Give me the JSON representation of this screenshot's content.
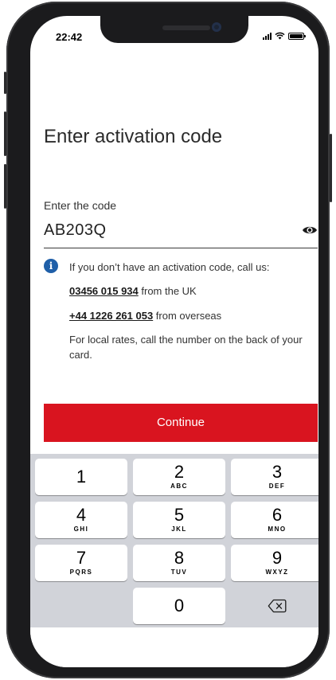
{
  "status_bar": {
    "time": "22:42"
  },
  "page": {
    "title": "Enter activation code",
    "code_label": "Enter the code",
    "code_value": "AB203Q"
  },
  "info": {
    "intro": "If you don’t have an activation code, call us:",
    "uk_number": "03456 015 934",
    "uk_suffix": " from the UK",
    "overseas_number": "+44 1226 261 053",
    "overseas_suffix": " from overseas",
    "note": "For local rates, call the number on the back of your card."
  },
  "continue_label": "Continue",
  "keypad": {
    "keys": [
      {
        "num": "1",
        "letters": ""
      },
      {
        "num": "2",
        "letters": "ABC"
      },
      {
        "num": "3",
        "letters": "DEF"
      },
      {
        "num": "4",
        "letters": "GHI"
      },
      {
        "num": "5",
        "letters": "JKL"
      },
      {
        "num": "6",
        "letters": "MNO"
      },
      {
        "num": "7",
        "letters": "PQRS"
      },
      {
        "num": "8",
        "letters": "TUV"
      },
      {
        "num": "9",
        "letters": "WXYZ"
      },
      {
        "num": "0",
        "letters": ""
      }
    ]
  },
  "colors": {
    "accent_red": "#d9141f",
    "info_blue": "#1f5fa8",
    "keyboard_bg": "#d1d3d9"
  },
  "icons": {
    "info": "info-icon",
    "eye": "eye-icon",
    "delete": "backspace-icon"
  }
}
